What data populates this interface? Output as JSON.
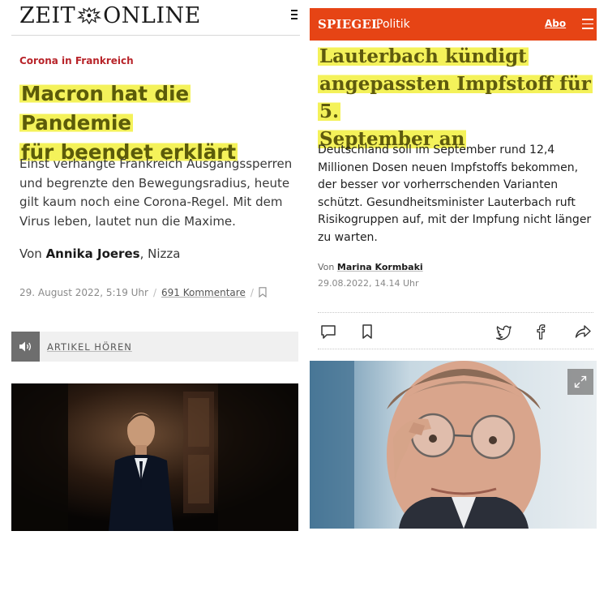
{
  "zeit": {
    "logo_left": "ZEIT",
    "logo_right": "ONLINE",
    "kicker": "Corona in Frankreich",
    "headline_line1": "Macron hat die Pandemie",
    "headline_line2": "für beendet erklärt",
    "teaser": "Einst verhängte Frankreich Ausgangssperren und begrenzte den Bewegungsradius, heute gilt kaum noch eine Corona-Regel. Mit dem Virus leben, lautet nun die Maxime.",
    "byline_prefix": "Von",
    "author": "Annika Joeres",
    "location": ", Nizza",
    "date": "29. August 2022, 5:19 Uhr",
    "separator": "/",
    "comments": "691 Kommentare",
    "audio_label": "ARTIKEL HÖREN",
    "icons": [
      "menu-icon",
      "bookmark-icon",
      "speaker-icon"
    ]
  },
  "spiegel": {
    "brand": "SPIEGEL",
    "section": "Politik",
    "abo": "Abo",
    "headline_line1": "Lauterbach kündigt",
    "headline_line2": "angepassten Impfstoff für 5.",
    "headline_line3": "September an",
    "teaser": "Deutschland soll im September rund 12,4 Millionen Dosen neuen Impfstoffs bekommen, der besser vor vorherrschenden Varianten schützt. Gesundheitsminister Lauterbach ruft Risikogruppen auf, mit der Impfung nicht länger zu warten.",
    "byline_prefix": "Von",
    "author": "Marina Kormbaki",
    "date": "29.08.2022, 14.14 Uhr",
    "icons": [
      "comment-icon",
      "bookmark-icon",
      "twitter-icon",
      "facebook-icon",
      "share-icon",
      "expand-icon",
      "menu-icon"
    ]
  },
  "colors": {
    "zeit_kicker": "#b8242a",
    "highlight": "#f4f25a",
    "spiegel_brand": "#e64415"
  }
}
